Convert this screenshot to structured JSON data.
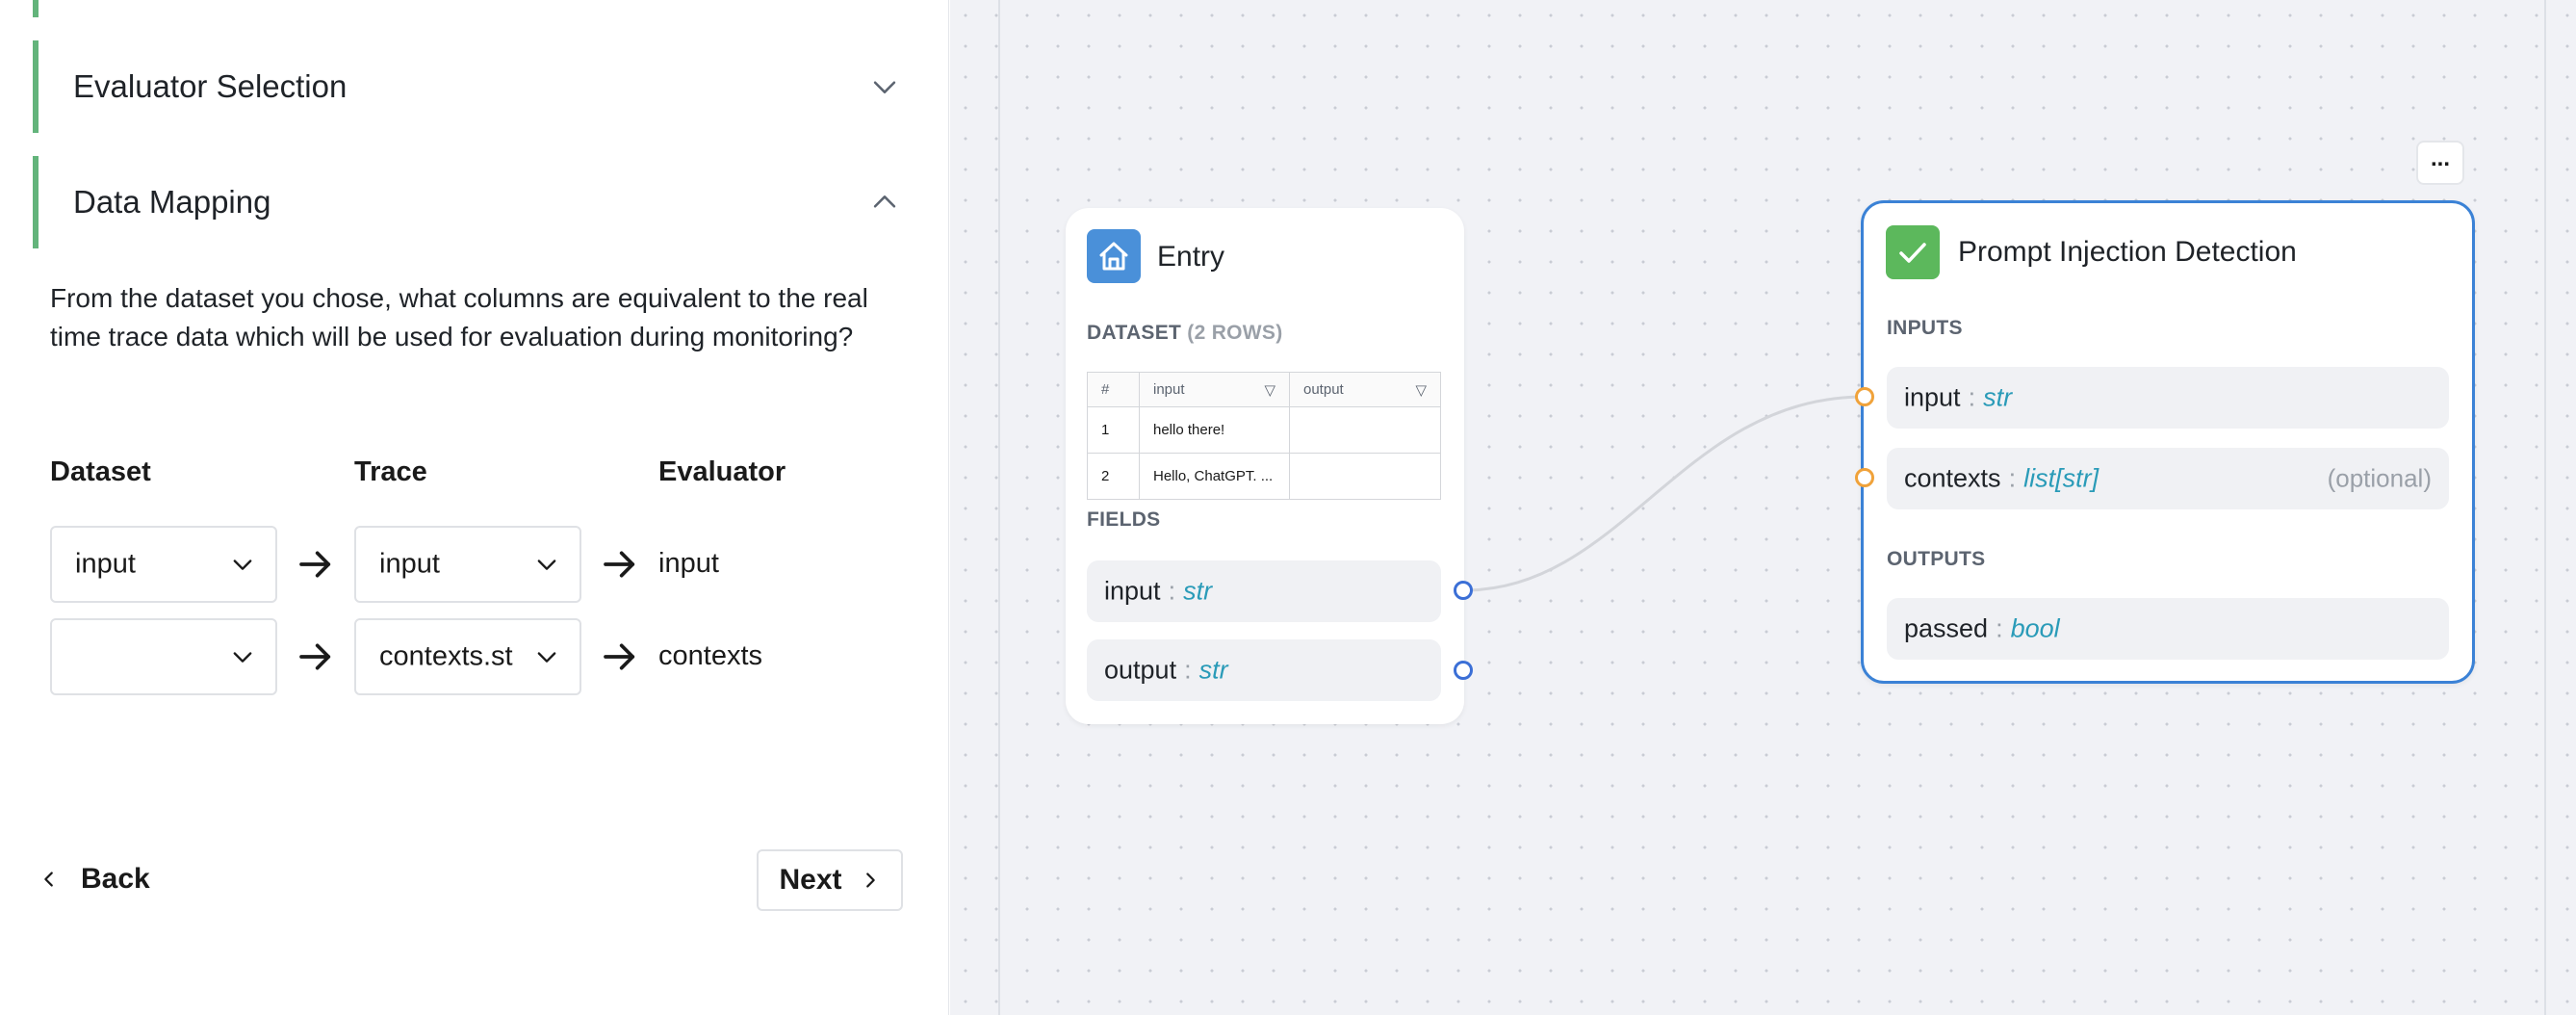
{
  "sections": {
    "evaluator_selection": "Evaluator Selection",
    "data_mapping": "Data Mapping"
  },
  "mapping": {
    "description": "From the dataset you chose, what columns are equivalent to the real time trace data which will be used for evaluation during monitoring?",
    "headers": {
      "dataset": "Dataset",
      "trace": "Trace",
      "evaluator": "Evaluator"
    },
    "rows": [
      {
        "dataset": "input",
        "trace": "input",
        "evaluator": "input"
      },
      {
        "dataset": "",
        "trace": "contexts.st",
        "evaluator": "contexts"
      }
    ]
  },
  "nav": {
    "back": "Back",
    "next": "Next"
  },
  "entry_node": {
    "title": "Entry",
    "dataset_label": "DATASET",
    "dataset_rows": "(2 ROWS)",
    "table": {
      "columns": [
        "#",
        "input",
        "output"
      ],
      "rows": [
        [
          "1",
          "hello there!",
          ""
        ],
        [
          "2",
          "Hello, ChatGPT. ...",
          ""
        ]
      ]
    },
    "fields_label": "FIELDS",
    "fields": [
      {
        "name": "input",
        "type": "str"
      },
      {
        "name": "output",
        "type": "str"
      }
    ]
  },
  "evaluator_node": {
    "title": "Prompt Injection Detection",
    "menu": "...",
    "inputs_label": "INPUTS",
    "inputs": [
      {
        "name": "input",
        "type": "str",
        "note": ""
      },
      {
        "name": "contexts",
        "type": "list[str]",
        "note": "(optional)"
      }
    ],
    "outputs_label": "OUTPUTS",
    "outputs": [
      {
        "name": "passed",
        "type": "bool"
      }
    ]
  },
  "colors": {
    "accent_green": "#63b47b",
    "entry_icon_bg": "#4a90d9",
    "evaluator_icon_bg": "#5cb85c",
    "selected_border": "#3b82d6",
    "handle_blue": "#3b6fd6",
    "handle_orange": "#f0a23a",
    "type_text": "#2a9bb8"
  }
}
